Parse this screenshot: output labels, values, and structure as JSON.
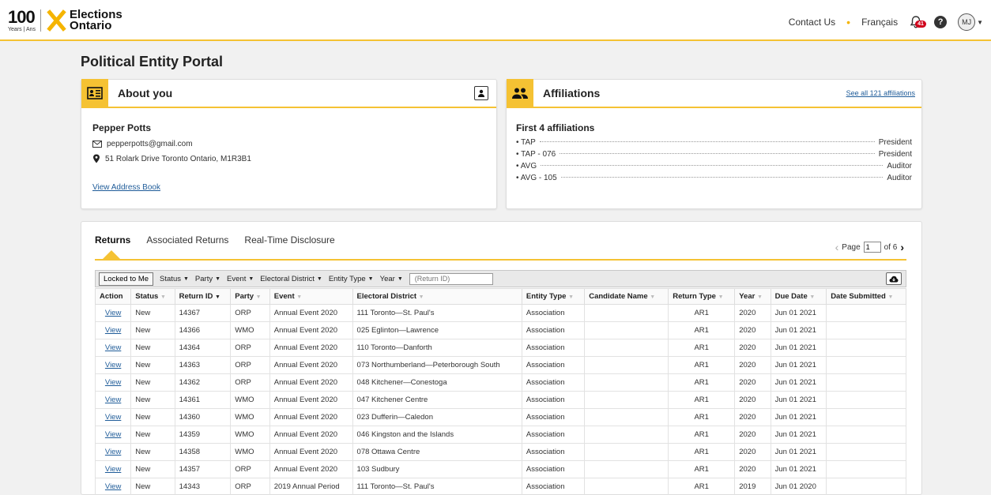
{
  "header": {
    "logo_100": "100",
    "logo_years": "Years | Ans",
    "logo_name_line1": "Elections",
    "logo_name_line2": "Ontario",
    "contact": "Contact Us",
    "language": "Français",
    "notification_count": "41",
    "help": "?",
    "user_initials": "MJ"
  },
  "page_title": "Political Entity Portal",
  "about": {
    "title": "About you",
    "name": "Pepper Potts",
    "email": "pepperpotts@gmail.com",
    "address": "51 Rolark Drive Toronto Ontario, M1R3B1",
    "address_book_link": "View Address Book"
  },
  "affiliations": {
    "title": "Affiliations",
    "see_all": "See all 121 affiliations",
    "subtitle": "First 4 affiliations",
    "items": [
      {
        "name": "• TAP",
        "role": "President"
      },
      {
        "name": "• TAP - 076",
        "role": "President"
      },
      {
        "name": "• AVG",
        "role": "Auditor"
      },
      {
        "name": "• AVG - 105",
        "role": "Auditor"
      }
    ]
  },
  "tabs": [
    "Returns",
    "Associated Returns",
    "Real-Time Disclosure"
  ],
  "pager": {
    "label": "Page",
    "current": "1",
    "total_label": "of 6"
  },
  "filters": {
    "locked": "Locked to Me",
    "items": [
      "Status",
      "Party",
      "Event",
      "Electoral District",
      "Entity Type",
      "Year"
    ],
    "return_id_placeholder": "(Return ID)"
  },
  "table": {
    "headers": [
      "Action",
      "Status",
      "Return ID",
      "Party",
      "Event",
      "Electoral District",
      "Entity Type",
      "Candidate Name",
      "Return Type",
      "Year",
      "Due Date",
      "Date Submitted"
    ],
    "rows": [
      [
        "View",
        "New",
        "14367",
        "ORP",
        "Annual Event 2020",
        "111 Toronto—St. Paul's",
        "Association",
        "",
        "AR1",
        "2020",
        "Jun 01 2021",
        ""
      ],
      [
        "View",
        "New",
        "14366",
        "WMO",
        "Annual Event 2020",
        "025 Eglinton—Lawrence",
        "Association",
        "",
        "AR1",
        "2020",
        "Jun 01 2021",
        ""
      ],
      [
        "View",
        "New",
        "14364",
        "ORP",
        "Annual Event 2020",
        "110 Toronto—Danforth",
        "Association",
        "",
        "AR1",
        "2020",
        "Jun 01 2021",
        ""
      ],
      [
        "View",
        "New",
        "14363",
        "ORP",
        "Annual Event 2020",
        "073 Northumberland—Peterborough South",
        "Association",
        "",
        "AR1",
        "2020",
        "Jun 01 2021",
        ""
      ],
      [
        "View",
        "New",
        "14362",
        "ORP",
        "Annual Event 2020",
        "048 Kitchener—Conestoga",
        "Association",
        "",
        "AR1",
        "2020",
        "Jun 01 2021",
        ""
      ],
      [
        "View",
        "New",
        "14361",
        "WMO",
        "Annual Event 2020",
        "047 Kitchener Centre",
        "Association",
        "",
        "AR1",
        "2020",
        "Jun 01 2021",
        ""
      ],
      [
        "View",
        "New",
        "14360",
        "WMO",
        "Annual Event 2020",
        "023 Dufferin—Caledon",
        "Association",
        "",
        "AR1",
        "2020",
        "Jun 01 2021",
        ""
      ],
      [
        "View",
        "New",
        "14359",
        "WMO",
        "Annual Event 2020",
        "046 Kingston and the Islands",
        "Association",
        "",
        "AR1",
        "2020",
        "Jun 01 2021",
        ""
      ],
      [
        "View",
        "New",
        "14358",
        "WMO",
        "Annual Event 2020",
        "078 Ottawa Centre",
        "Association",
        "",
        "AR1",
        "2020",
        "Jun 01 2021",
        ""
      ],
      [
        "View",
        "New",
        "14357",
        "ORP",
        "Annual Event 2020",
        "103 Sudbury",
        "Association",
        "",
        "AR1",
        "2020",
        "Jun 01 2021",
        ""
      ],
      [
        "View",
        "New",
        "14343",
        "ORP",
        "2019 Annual Period",
        "111 Toronto—St. Paul's",
        "Association",
        "",
        "AR1",
        "2019",
        "Jun 01 2020",
        ""
      ]
    ]
  },
  "colors": {
    "accent": "#f5c233",
    "link": "#1f5c99",
    "badge": "#d0021b"
  }
}
